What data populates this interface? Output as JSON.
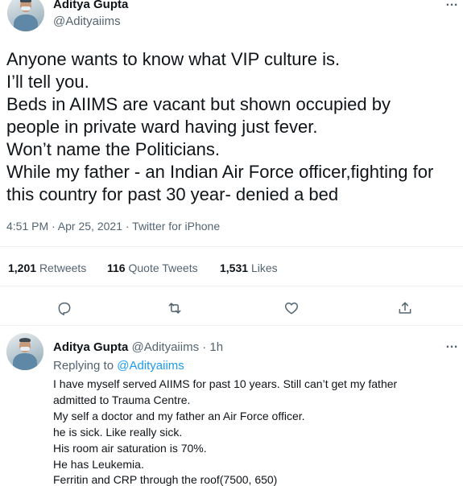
{
  "tweet": {
    "author_name": "Aditya Gupta",
    "author_handle": "@Adityaiims",
    "more_icon": "…",
    "text_lines": [
      "Anyone wants to know what VIP culture is.",
      "I’ll tell you.",
      "Beds in AIIMS are vacant but shown occupied by",
      "people in private ward having just fever.",
      "Won’t name the Politicians.",
      "While my father - an Indian Air Force officer,fighting for",
      "this country for past 30 year- denied a bed"
    ],
    "meta": "4:51 PM · Apr 25, 2021 · Twitter for iPhone",
    "stats": {
      "retweets_count": "1,201",
      "retweets_label": "Retweets",
      "quotes_count": "116",
      "quotes_label": "Quote Tweets",
      "likes_count": "1,531",
      "likes_label": "Likes"
    },
    "actions": [
      "reply-icon",
      "retweet-icon",
      "like-icon",
      "share-icon"
    ]
  },
  "reply": {
    "author_name": "Aditya Gupta",
    "author_handle": "@Adityaiims",
    "time": "· 1h",
    "more_icon": "…",
    "replying_prefix": "Replying to",
    "replying_handle": "@Adityaiims",
    "text_lines": [
      "I have myself served AIIMS for past 10 years. Still can’t get my father",
      "admitted to Trauma Centre.",
      "My self a doctor and my father an Air Force officer.",
      "he is sick. Like really sick.",
      "His room air saturation is 70%.",
      "He has Leukemia.",
      "Ferritin and CRP through the roof(7500, 650)"
    ]
  },
  "colors": {
    "text": "#0f1419",
    "secondary": "#536471",
    "link": "#1d9bf0",
    "divider": "#eff3f4"
  }
}
